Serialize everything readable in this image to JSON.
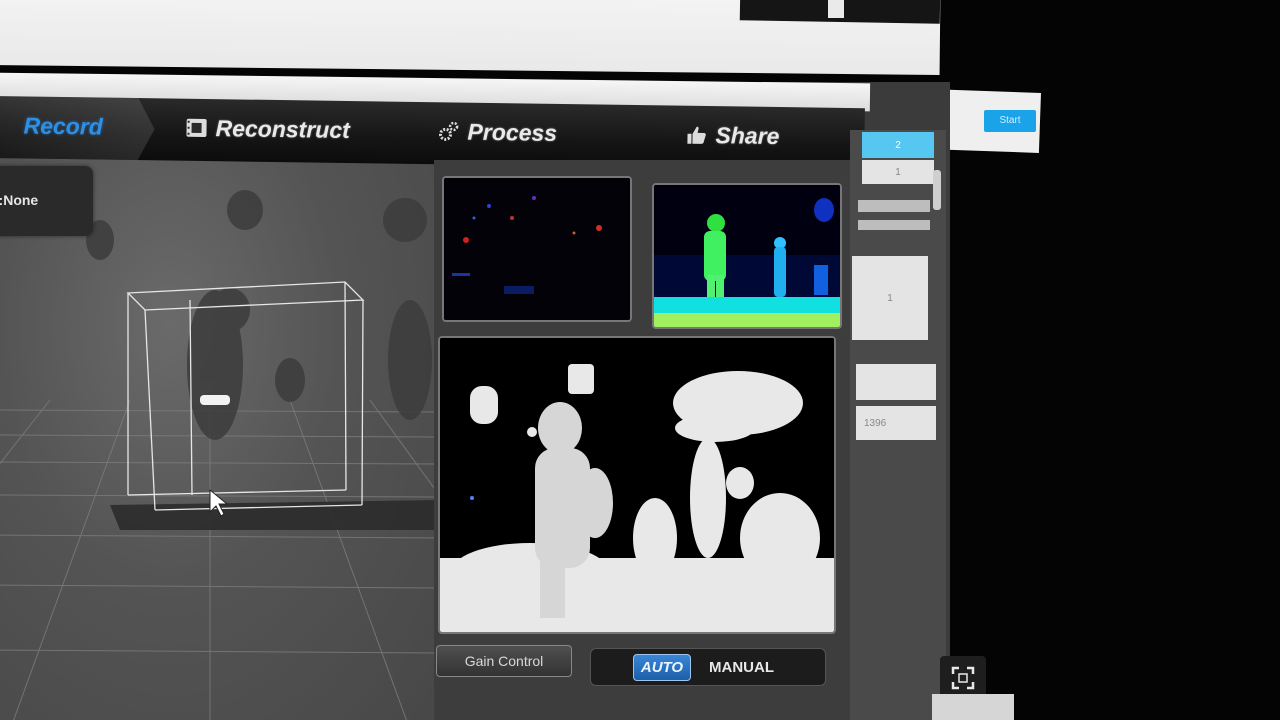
{
  "tabs": [
    {
      "label": "Record",
      "icon": "record-icon",
      "active": true
    },
    {
      "label": "Reconstruct",
      "icon": "film-icon",
      "active": false
    },
    {
      "label": "Process",
      "icon": "gears-icon",
      "active": false
    },
    {
      "label": "Share",
      "icon": "thumbs-up-icon",
      "active": false
    }
  ],
  "viewport": {
    "unit_label": "it:None"
  },
  "controls": {
    "gain_control_label": "Gain Control",
    "mode_auto_label": "AUTO",
    "mode_manual_label": "MANUAL",
    "selected_mode": "AUTO"
  },
  "side_panel": {
    "items": [
      {
        "value": "2"
      },
      {
        "value": "1"
      },
      {
        "value": "1"
      },
      {
        "value": ""
      },
      {
        "value": "1396"
      }
    ]
  },
  "top_right_button": {
    "label": "Start"
  },
  "colors": {
    "accent": "#2e8fe6",
    "auto_button": "#2a74c4",
    "selected_cell": "#55c7f0",
    "viewport_bg": "#555555"
  }
}
